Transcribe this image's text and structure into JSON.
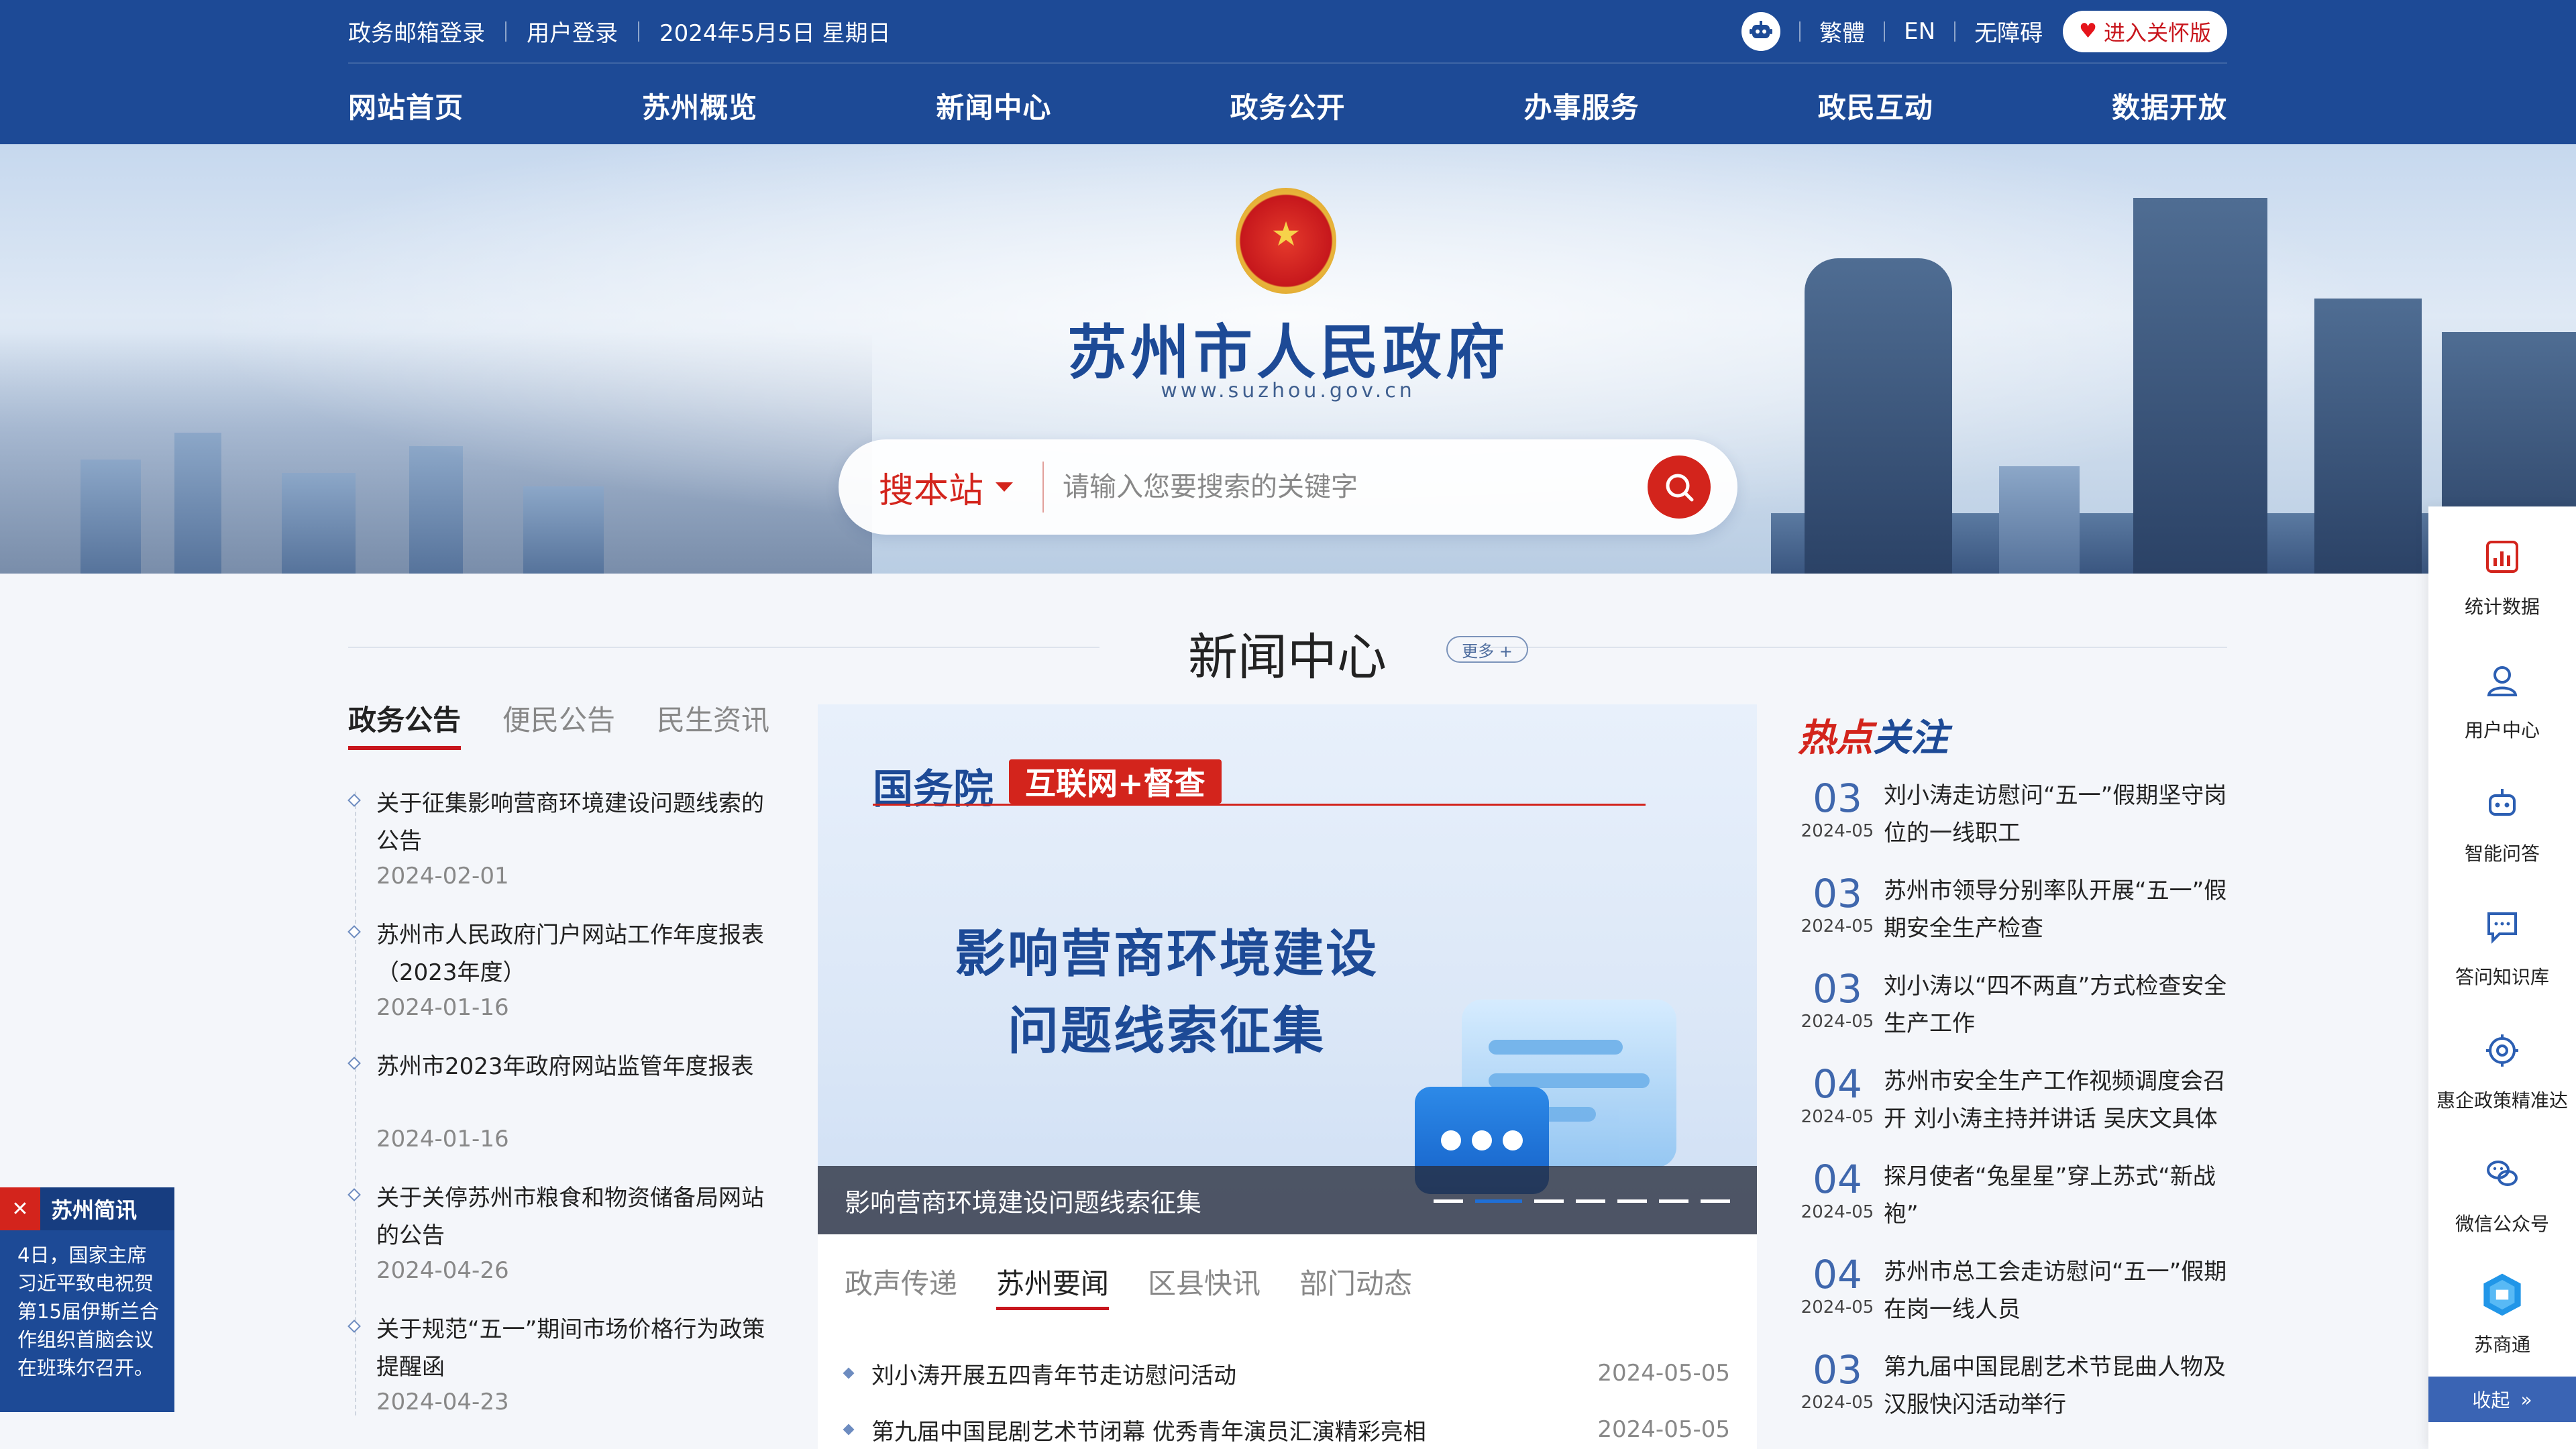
{
  "topbar": {
    "links_left": [
      "政务邮箱登录",
      "用户登录"
    ],
    "date": "2024年5月5日 星期日",
    "traditional": "繁體",
    "english": "EN",
    "accessibility": "无障碍",
    "care_mode": "进入关怀版"
  },
  "nav": [
    "网站首页",
    "苏州概览",
    "新闻中心",
    "政务公开",
    "办事服务",
    "政民互动",
    "数据开放"
  ],
  "banner": {
    "title": "苏州市人民政府",
    "url": "www.suzhou.gov.cn",
    "search_scope": "搜本站",
    "search_placeholder": "请输入您要搜索的关键字"
  },
  "news_center": {
    "title": "新闻中心",
    "more": "更多 +"
  },
  "left_panel": {
    "tabs": [
      "政务公告",
      "便民公告",
      "民生资讯"
    ],
    "items": [
      {
        "title": "关于征集影响营商环境建设问题线索的公告",
        "date": "2024-02-01"
      },
      {
        "title": "苏州市人民政府门户网站工作年度报表（2023年度）",
        "date": "2024-01-16"
      },
      {
        "title": "苏州市2023年政府网站监管年度报表",
        "date": "2024-01-16"
      },
      {
        "title": "关于关停苏州市粮食和物资储备局网站的公告",
        "date": "2024-04-26"
      },
      {
        "title": "关于规范“五一”期间市场价格行为政策提醒函",
        "date": "2024-04-23"
      }
    ]
  },
  "carousel": {
    "brand": "国务院",
    "tag": "互联网+督查",
    "headline_line1": "影响营商环境建设",
    "headline_line2": "问题线索征集",
    "caption": "影响营商环境建设问题线索征集",
    "slide_count": 8,
    "active_slide": 2
  },
  "center_panel": {
    "tabs": [
      "政声传递",
      "苏州要闻",
      "区县快讯",
      "部门动态"
    ],
    "active_tab": "苏州要闻",
    "items": [
      {
        "title": "刘小涛开展五四青年节走访慰问活动",
        "date": "2024-05-05"
      },
      {
        "title": "第九届中国昆剧艺术节闭幕 优秀青年演员汇演精彩亮相",
        "date": "2024-05-05"
      }
    ]
  },
  "hot_focus": {
    "title_a": "热点",
    "title_b": "关注",
    "items": [
      {
        "day": "03",
        "ym": "2024-05",
        "title": "刘小涛走访慰问“五一”假期坚守岗位的一线职工"
      },
      {
        "day": "03",
        "ym": "2024-05",
        "title": "苏州市领导分别率队开展“五一”假期安全生产检查"
      },
      {
        "day": "03",
        "ym": "2024-05",
        "title": "刘小涛以“四不两直”方式检查安全生产工作"
      },
      {
        "day": "04",
        "ym": "2024-05",
        "title": "苏州市安全生产工作视频调度会召开 刘小涛主持并讲话 吴庆文具体部..."
      },
      {
        "day": "04",
        "ym": "2024-05",
        "title": "探月使者“兔星星”穿上苏式“新战袍”"
      },
      {
        "day": "04",
        "ym": "2024-05",
        "title": "苏州市总工会走访慰问“五一”假期在岗一线人员"
      },
      {
        "day": "03",
        "ym": "2024-05",
        "title": "第九届中国昆剧艺术节昆曲人物及汉服快闪活动举行"
      }
    ]
  },
  "sidebar": {
    "items": [
      {
        "label": "统计数据",
        "icon": "chart-icon"
      },
      {
        "label": "用户中心",
        "icon": "user-icon"
      },
      {
        "label": "智能问答",
        "icon": "robot-icon"
      },
      {
        "label": "答问知识库",
        "icon": "chat-icon"
      },
      {
        "label": "惠企政策精准达",
        "icon": "target-icon"
      },
      {
        "label": "微信公众号",
        "icon": "wechat-icon"
      },
      {
        "label": "苏商通",
        "icon": "sushangtong-icon"
      }
    ],
    "collapse": "收起"
  },
  "brief": {
    "title": "苏州简讯",
    "text": "4日，国家主席习近平致电祝贺第15届伊斯兰合作组织首脑会议在班珠尔召开。"
  },
  "colors": {
    "primary": "#1d4a96",
    "accent_red": "#d3241c"
  }
}
